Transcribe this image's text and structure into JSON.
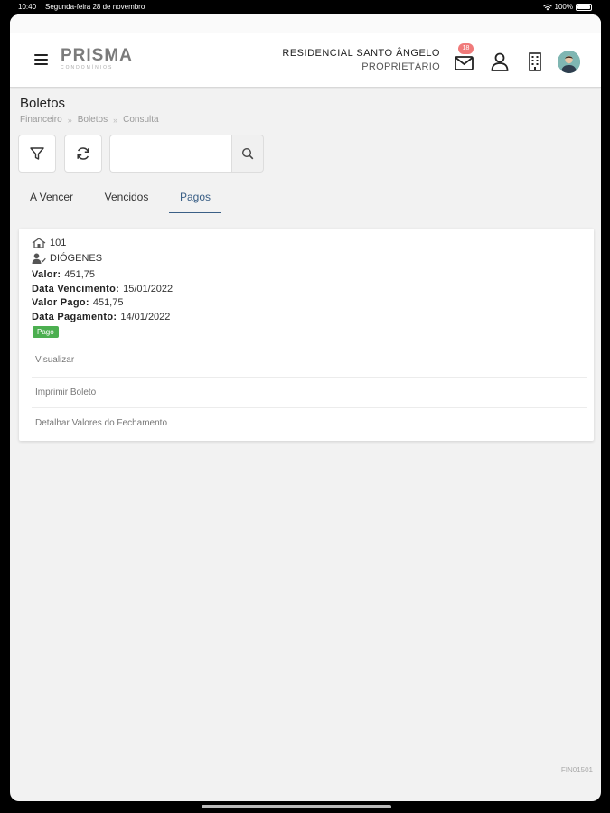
{
  "status_bar": {
    "time": "10:40",
    "date": "Segunda-feira 28 de novembro",
    "battery": "100%"
  },
  "header": {
    "logo_brand": "PRISMA",
    "logo_sub": "CONDOMÍNIOS",
    "condo_name": "RESIDENCIAL SANTO ÂNGELO",
    "condo_role": "PROPRIETÁRIO",
    "mail_count": "18",
    "icons": [
      "menu-icon",
      "mail-icon",
      "user-icon",
      "building-icon"
    ]
  },
  "page": {
    "title": "Boletos",
    "breadcrumb": [
      "Financeiro",
      "Boletos",
      "Consulta"
    ]
  },
  "search": {
    "value": "",
    "placeholder": ""
  },
  "tabs": [
    {
      "label": "A Vencer",
      "active": false
    },
    {
      "label": "Vencidos",
      "active": false
    },
    {
      "label": "Pagos",
      "active": true
    }
  ],
  "boleto": {
    "unit": "101",
    "owner": "DIÓGENES",
    "valor_label": "Valor:",
    "valor": "451,75",
    "vencimento_label": "Data Vencimento:",
    "vencimento": "15/01/2022",
    "valor_pago_label": "Valor Pago:",
    "valor_pago": "451,75",
    "pagamento_label": "Data Pagamento:",
    "pagamento": "14/01/2022",
    "status": "Pago",
    "status_color": "#4caf50",
    "actions": [
      "Visualizar",
      "Imprimir Boleto",
      "Detalhar Valores do Fechamento"
    ]
  },
  "footer": {
    "code": "FIN01501"
  },
  "colors": {
    "accent": "#3a5f86",
    "badge": "#f07a7a",
    "background": "#f2f2f2"
  }
}
